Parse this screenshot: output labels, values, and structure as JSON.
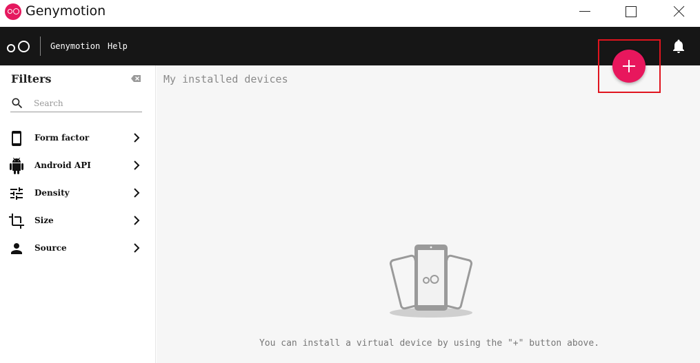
{
  "window": {
    "title": "Genymotion",
    "controls": [
      "minimize",
      "maximize",
      "close"
    ]
  },
  "appbar": {
    "menu": [
      {
        "label": "Genymotion"
      },
      {
        "label": "Help"
      }
    ],
    "notifications_icon": "bell-icon"
  },
  "sidebar": {
    "title": "Filters",
    "clear_icon": "backspace-icon",
    "search": {
      "placeholder": "Search",
      "value": ""
    },
    "items": [
      {
        "label": "Form factor",
        "icon": "phone-icon"
      },
      {
        "label": "Android API",
        "icon": "android-icon"
      },
      {
        "label": "Density",
        "icon": "tune-icon"
      },
      {
        "label": "Size",
        "icon": "crop-icon"
      },
      {
        "label": "Source",
        "icon": "person-icon"
      }
    ]
  },
  "main": {
    "title": "My installed devices",
    "empty_hint": "You can install a virtual device by using the \"+\" button above."
  },
  "colors": {
    "brand": "#e8175d",
    "appbar": "#161616",
    "highlight": "#e0141e"
  }
}
